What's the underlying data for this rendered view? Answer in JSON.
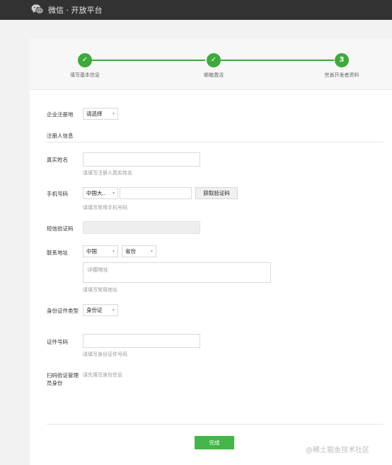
{
  "header": {
    "brand": "微信 · 开放平台",
    "logo_icon": "wechat-logo-icon"
  },
  "steps": [
    {
      "marker": "✓",
      "label": "填写基本信息",
      "status": "done"
    },
    {
      "marker": "✓",
      "label": "邮箱激活",
      "status": "done"
    },
    {
      "marker": "3",
      "label": "完善开发者资料",
      "status": "current"
    }
  ],
  "form": {
    "region_label": "企业注册地",
    "region_value": "请选择",
    "section_title": "注册人信息",
    "name_label": "真实姓名",
    "name_hint": "请填写注册人真实姓名",
    "phone_label": "手机号码",
    "phone_country": "中国大..",
    "phone_hint": "请填写常用手机号码",
    "get_code_button": "获取验证码",
    "sms_label": "短信验证码",
    "address_label": "联系地址",
    "address_country": "中国",
    "address_province": "省份",
    "address_placeholder": "详细地址",
    "address_hint": "请填写常用地址",
    "id_type_label": "身份证件类型",
    "id_type_value": "身份证",
    "id_number_label": "证件号码",
    "id_number_hint": "请填写身份证件号码",
    "scan_label": "扫码验证管理员身份",
    "scan_hint": "请先填写身份信息"
  },
  "footer": {
    "submit_button": "完成"
  },
  "watermark": "@稀土掘金技术社区",
  "colors": {
    "accent": "#44b549",
    "topbar": "#323232"
  }
}
